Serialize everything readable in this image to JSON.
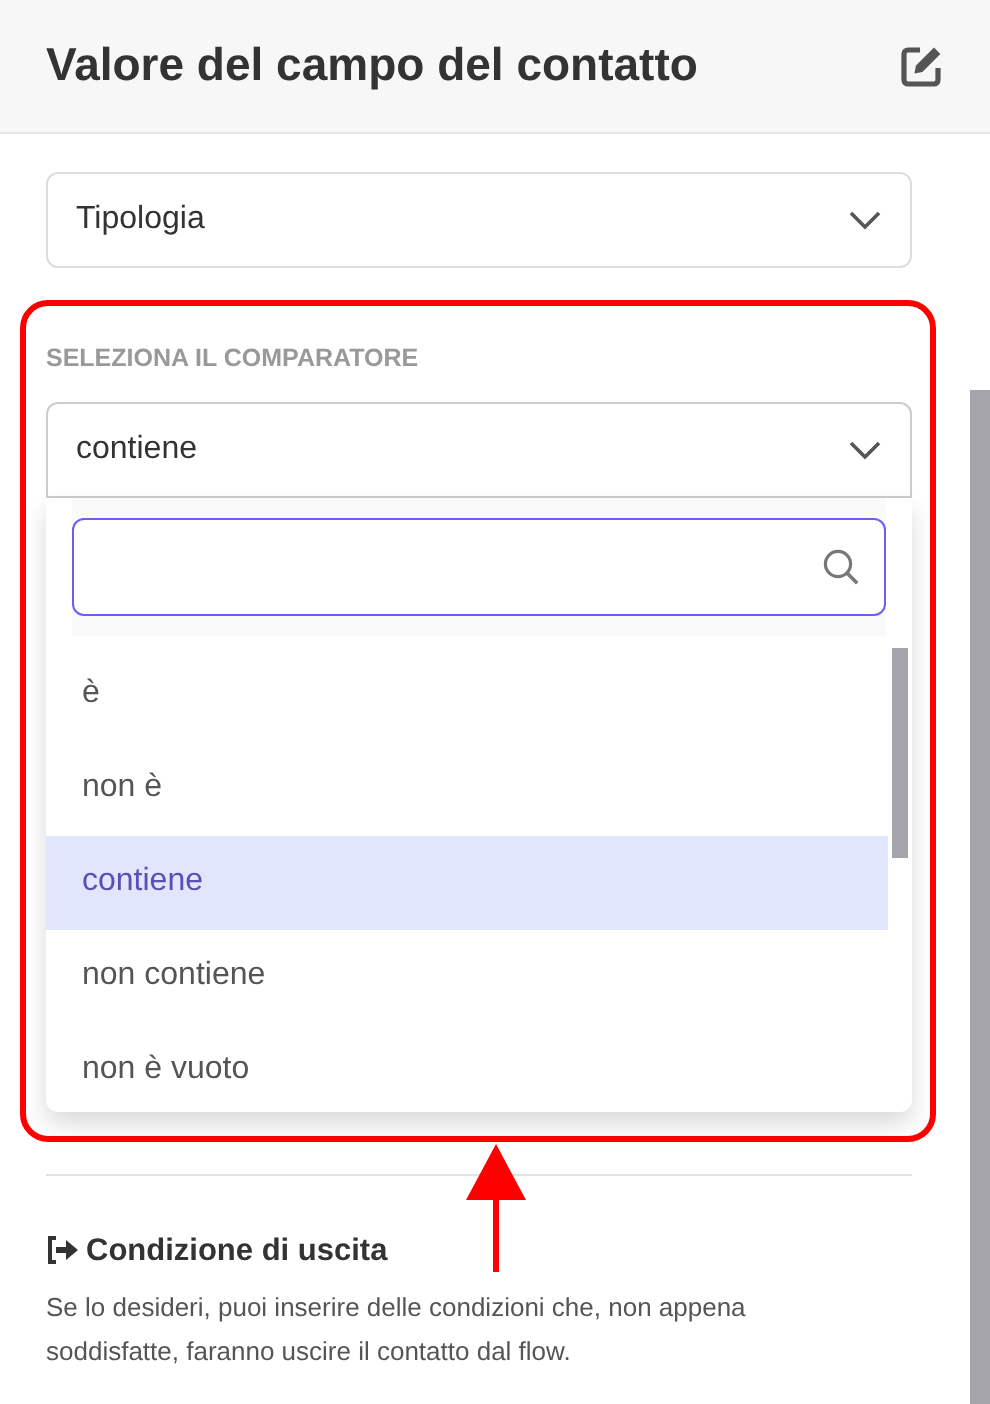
{
  "header": {
    "title": "Valore del campo del contatto"
  },
  "field_select": {
    "value": "Tipologia"
  },
  "comparator": {
    "label": "SELEZIONA IL COMPARATORE",
    "value": "contiene",
    "expanded": true,
    "options": [
      {
        "label": "è",
        "selected": false
      },
      {
        "label": "non è",
        "selected": false
      },
      {
        "label": "contiene",
        "selected": true
      },
      {
        "label": "non contiene",
        "selected": false
      },
      {
        "label": "non è vuoto",
        "selected": false
      }
    ]
  },
  "exit_condition": {
    "title": "Condizione di uscita",
    "description": "Se lo desideri, puoi inserire delle condizioni che, non appena soddisfatte, faranno uscire il contatto dal flow."
  }
}
